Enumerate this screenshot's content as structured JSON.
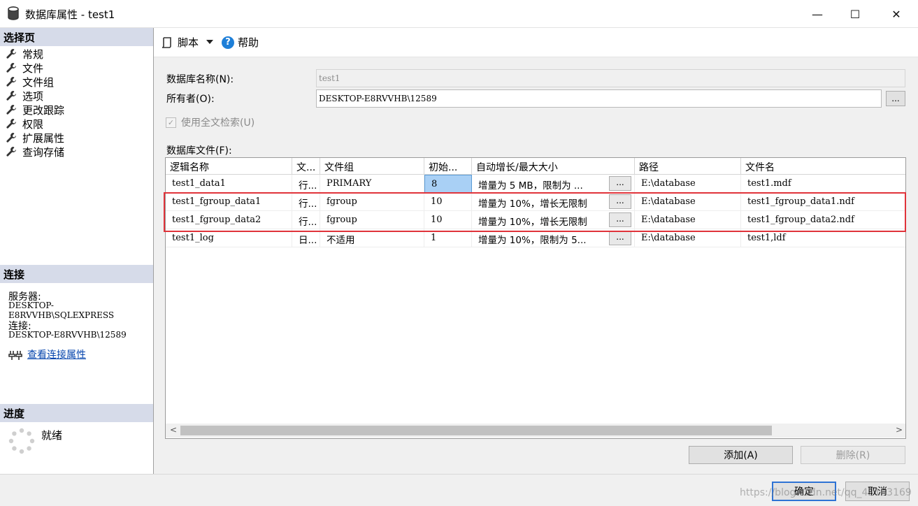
{
  "window": {
    "title": "数据库属性 - test1",
    "minimize": "—",
    "maximize": "☐",
    "close": "✕"
  },
  "left": {
    "select_page_header": "选择页",
    "nav_items": [
      "常规",
      "文件",
      "文件组",
      "选项",
      "更改跟踪",
      "权限",
      "扩展属性",
      "查询存储"
    ],
    "connection_header": "连接",
    "server_label": "服务器:",
    "server_value": "DESKTOP-E8RVVHB\\SQLEXPRESS",
    "connection_label": "连接:",
    "connection_value": "DESKTOP-E8RVVHB\\12589",
    "view_connection_link": "查看连接属性",
    "progress_header": "进度",
    "progress_status": "就绪"
  },
  "toolbar": {
    "script_label": "脚本",
    "help_label": "帮助"
  },
  "form": {
    "db_name_label": "数据库名称(N):",
    "db_name_value": "test1",
    "owner_label": "所有者(O):",
    "owner_value": "DESKTOP-E8RVVHB\\12589",
    "owner_browse": "...",
    "fulltext_label": "使用全文检索(U)",
    "fulltext_checked": true,
    "db_files_label": "数据库文件(F):"
  },
  "grid": {
    "columns": [
      "逻辑名称",
      "文...",
      "文件组",
      "初始...",
      "自动增长/最大大小",
      "路径",
      "文件名"
    ],
    "rows": [
      {
        "logical": "test1_data1",
        "type": "行...",
        "group": "PRIMARY",
        "size": "8",
        "growth": "增量为 5 MB，限制为 ...",
        "path": "E:\\database",
        "file": "test1.mdf"
      },
      {
        "logical": "test1_fgroup_data1",
        "type": "行...",
        "group": "fgroup",
        "size": "10",
        "growth": "增量为 10%，增长无限制",
        "path": "E:\\database",
        "file": "test1_fgroup_data1.ndf"
      },
      {
        "logical": "test1_fgroup_data2",
        "type": "行...",
        "group": "fgroup",
        "size": "10",
        "growth": "增量为 10%，增长无限制",
        "path": "E:\\database",
        "file": "test1_fgroup_data2.ndf"
      },
      {
        "logical": "test1_log",
        "type": "日...",
        "group": "不适用",
        "size": "1",
        "growth": "增量为 10%，限制为 5...",
        "path": "E:\\database",
        "file": "test1,ldf"
      }
    ],
    "ellipsis": "...",
    "scroll_left": "<",
    "scroll_right": ">"
  },
  "buttons": {
    "add": "添加(A)",
    "remove": "删除(R)",
    "ok": "确定",
    "cancel": "取消"
  },
  "watermark": "https://blog.csdn.net/qq_42163169",
  "colors": {
    "highlight": "#e0333a",
    "section_header": "#d6dbe9",
    "link": "#0645ad",
    "selected_cell": "#a9d0f5"
  }
}
